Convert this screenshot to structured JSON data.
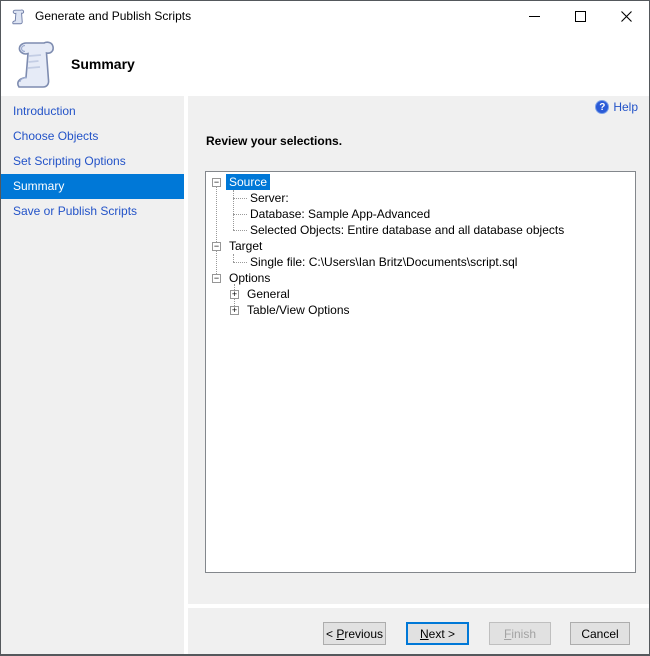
{
  "window": {
    "title": "Generate and Publish Scripts"
  },
  "header": {
    "step_title": "Summary"
  },
  "sidebar": {
    "items": [
      {
        "label": "Introduction",
        "active": false
      },
      {
        "label": "Choose Objects",
        "active": false
      },
      {
        "label": "Set Scripting Options",
        "active": false
      },
      {
        "label": "Summary",
        "active": true
      },
      {
        "label": "Save or Publish Scripts",
        "active": false
      }
    ]
  },
  "main": {
    "help_label": "Help",
    "help_glyph": "?",
    "review_heading": "Review your selections.",
    "tree": {
      "rows": [
        {
          "label": "Source",
          "level": 0,
          "expander": "−",
          "selected": true
        },
        {
          "label": "Server:",
          "level": 1
        },
        {
          "label": "Database: Sample App-Advanced",
          "level": 1
        },
        {
          "label": "Selected Objects: Entire database and all database objects",
          "level": 1
        },
        {
          "label": "Target",
          "level": 0,
          "expander": "−",
          "selected": false
        },
        {
          "label": "Single file: C:\\Users\\Ian Britz\\Documents\\script.sql",
          "level": 1
        },
        {
          "label": "Options",
          "level": 0,
          "expander": "−",
          "selected": false
        },
        {
          "label": "General",
          "level": 1,
          "expander": "+"
        },
        {
          "label": "Table/View Options",
          "level": 1,
          "expander": "+"
        }
      ]
    }
  },
  "footer": {
    "buttons": {
      "previous": {
        "prefix": "< ",
        "mnemonic": "P",
        "rest": "revious",
        "state": "enabled"
      },
      "next": {
        "prefix": "",
        "mnemonic": "N",
        "rest": "ext >",
        "state": "focused"
      },
      "finish": {
        "prefix": "",
        "mnemonic": "F",
        "rest": "inish",
        "state": "disabled"
      },
      "cancel": {
        "prefix": "",
        "mnemonic": "",
        "rest": "Cancel",
        "state": "enabled"
      }
    }
  },
  "colors": {
    "accent": "#0078d7",
    "link_blue": "#2353c8",
    "panel_gray": "#f0f0f0",
    "button_face": "#e1e1e1",
    "disabled_text": "#a3a3a3"
  }
}
